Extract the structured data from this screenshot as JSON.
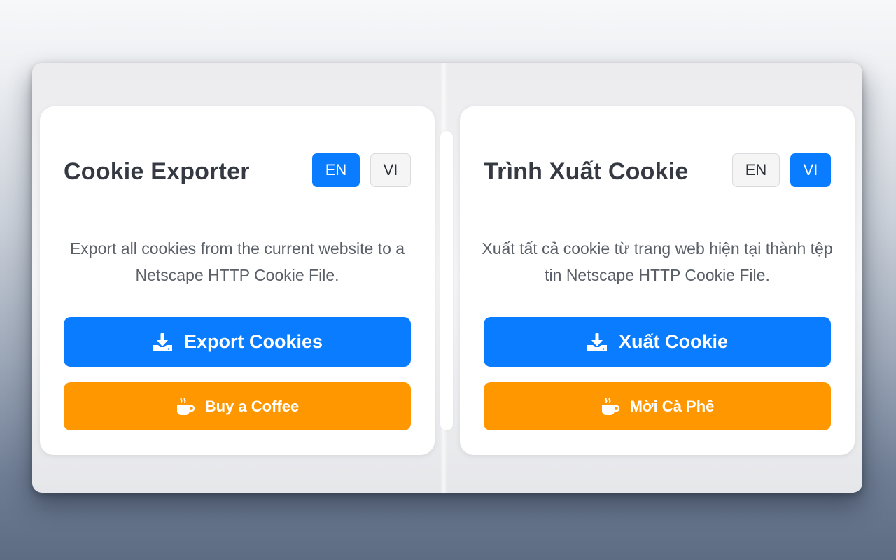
{
  "cards": [
    {
      "title": "Cookie Exporter",
      "lang_en": "EN",
      "lang_vi": "VI",
      "active_lang": "EN",
      "description": "Export all cookies from the current website to a Netscape HTTP Cookie File.",
      "export_label": "Export Cookies",
      "coffee_label": "Buy a Coffee"
    },
    {
      "title": "Trình Xuất Cookie",
      "lang_en": "EN",
      "lang_vi": "VI",
      "active_lang": "VI",
      "description": "Xuất tất cả cookie từ trang web hiện tại thành tệp tin Netscape HTTP Cookie File.",
      "export_label": "Xuất Cookie",
      "coffee_label": "Mời Cà Phê"
    }
  ],
  "icons": {
    "export": "download-icon",
    "coffee": "coffee-cup-icon"
  },
  "colors": {
    "primary": "#0a7cff",
    "coffee": "#ff9800",
    "title": "#353a42",
    "description": "#5b6068"
  }
}
